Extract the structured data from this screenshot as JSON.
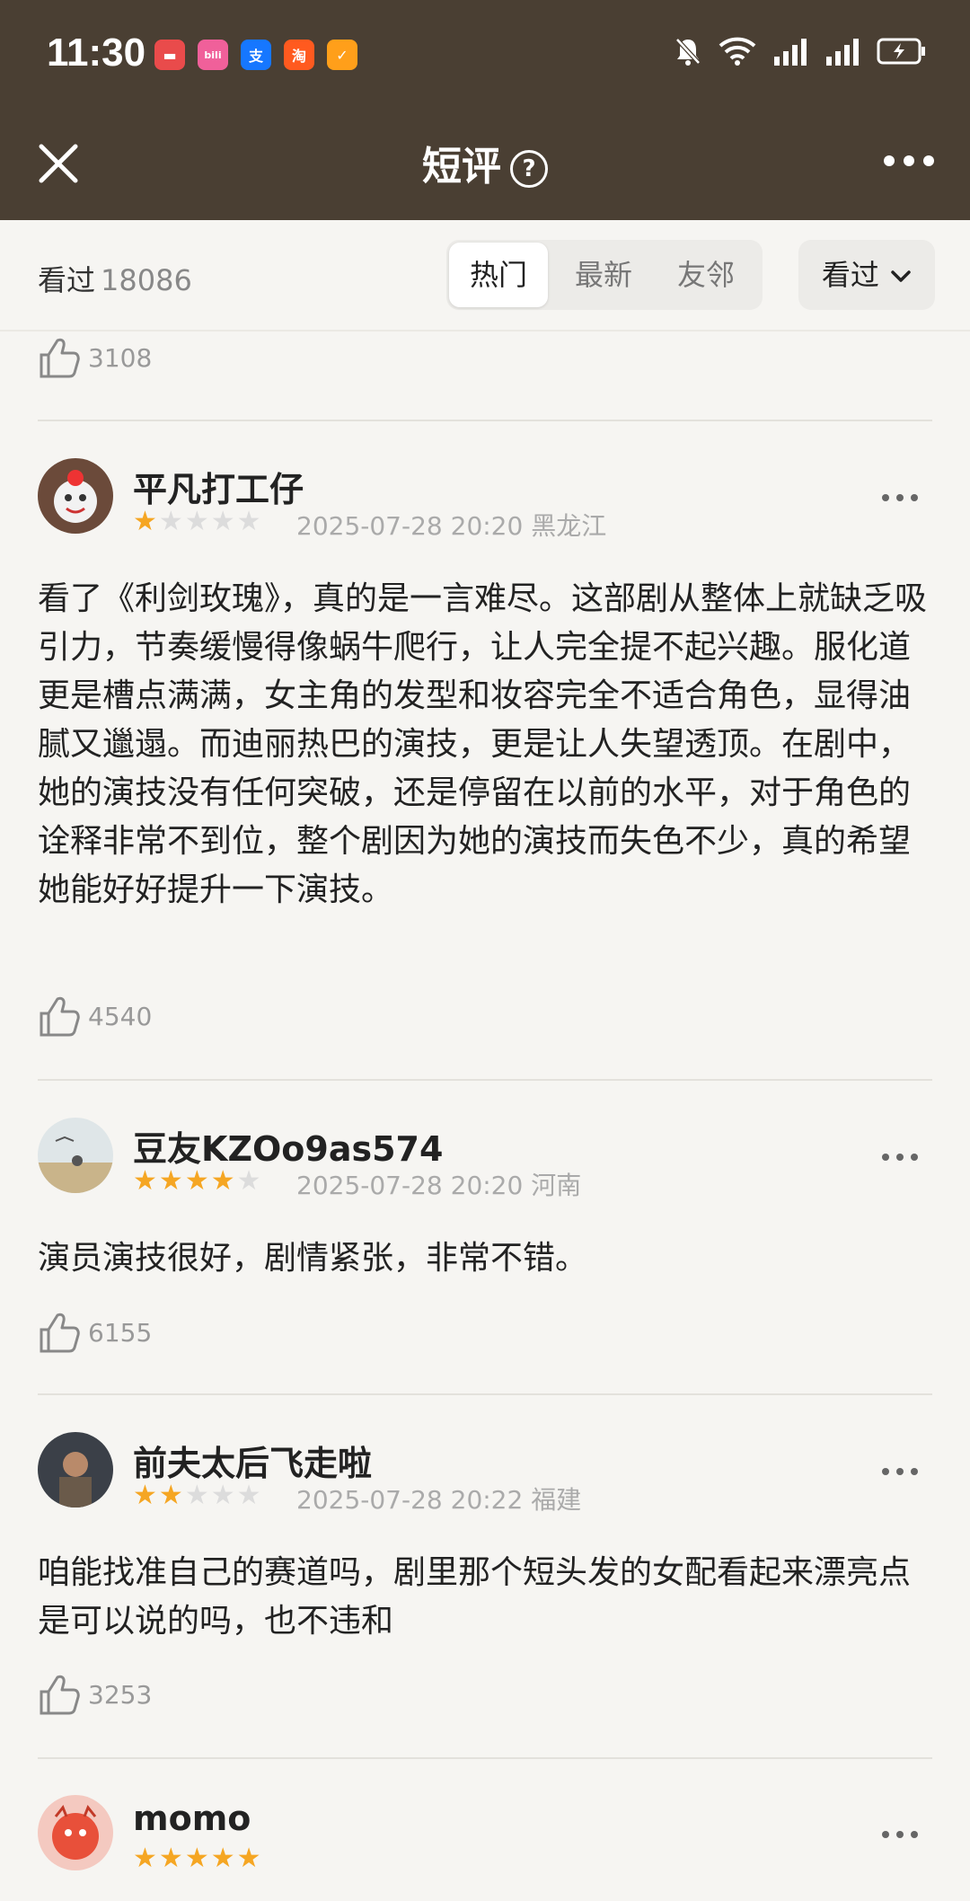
{
  "status_bar": {
    "time": "11:30"
  },
  "header": {
    "title": "短评",
    "help_glyph": "?"
  },
  "filter": {
    "seen_label": "看过",
    "seen_count": "18086",
    "tabs": [
      "热门",
      "最新",
      "友邻"
    ],
    "dropdown_label": "看过"
  },
  "top_like_count": "3108",
  "reviews": [
    {
      "name": "平凡打工仔",
      "rating": 1,
      "date": "2025-07-28 20:20",
      "location": "黑龙江",
      "text": "看了《利剑玫瑰》，真的是一言难尽。这部剧从整体上就缺乏吸引力，节奏缓慢得像蜗牛爬行，让人完全提不起兴趣。服化道更是槽点满满，女主角的发型和妆容完全不适合角色，显得油腻又邋遢。而迪丽热巴的演技，更是让人失望透顶。在剧中，她的演技没有任何突破，还是停留在以前的水平，对于角色的诠释非常不到位，整个剧因为她的演技而失色不少，真的希望她能好好提升一下演技。",
      "likes": "4540"
    },
    {
      "name": "豆友KZOo9as574",
      "rating": 4,
      "date": "2025-07-28 20:20",
      "location": "河南",
      "text": "演员演技很好，剧情紧张，非常不错。",
      "likes": "6155"
    },
    {
      "name": "前夫太后飞走啦",
      "rating": 2,
      "date": "2025-07-28 20:22",
      "location": "福建",
      "text": "咱能找准自己的赛道吗，剧里那个短头发的女配看起来漂亮点是可以说的吗，也不违和",
      "likes": "3253"
    },
    {
      "name": "momo",
      "rating": 5,
      "date": "",
      "location": "",
      "text": "",
      "likes": ""
    }
  ],
  "colors": {
    "header_bg": "#4a3f33",
    "star_on": "#f5a623",
    "star_off": "#dcdcdc"
  }
}
